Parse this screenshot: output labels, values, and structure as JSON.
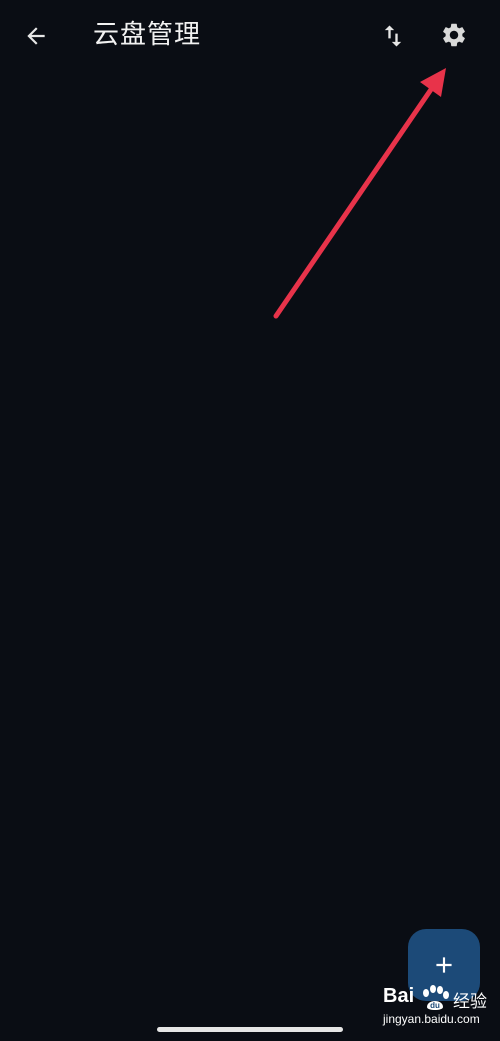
{
  "header": {
    "title": "云盘管理",
    "back_icon": "arrow-left-icon",
    "sort_icon": "sort-swap-icon",
    "settings_icon": "gear-icon"
  },
  "fab": {
    "icon": "plus-icon",
    "color": "#1c4a78"
  },
  "annotation": {
    "color": "#e8334a"
  },
  "watermark": {
    "brand": "Bai",
    "brand_du": "du",
    "cn": "经验",
    "url": "jingyan.baidu.com"
  },
  "colors": {
    "background": "#0a0d14",
    "icon": "#e6e6e6"
  }
}
